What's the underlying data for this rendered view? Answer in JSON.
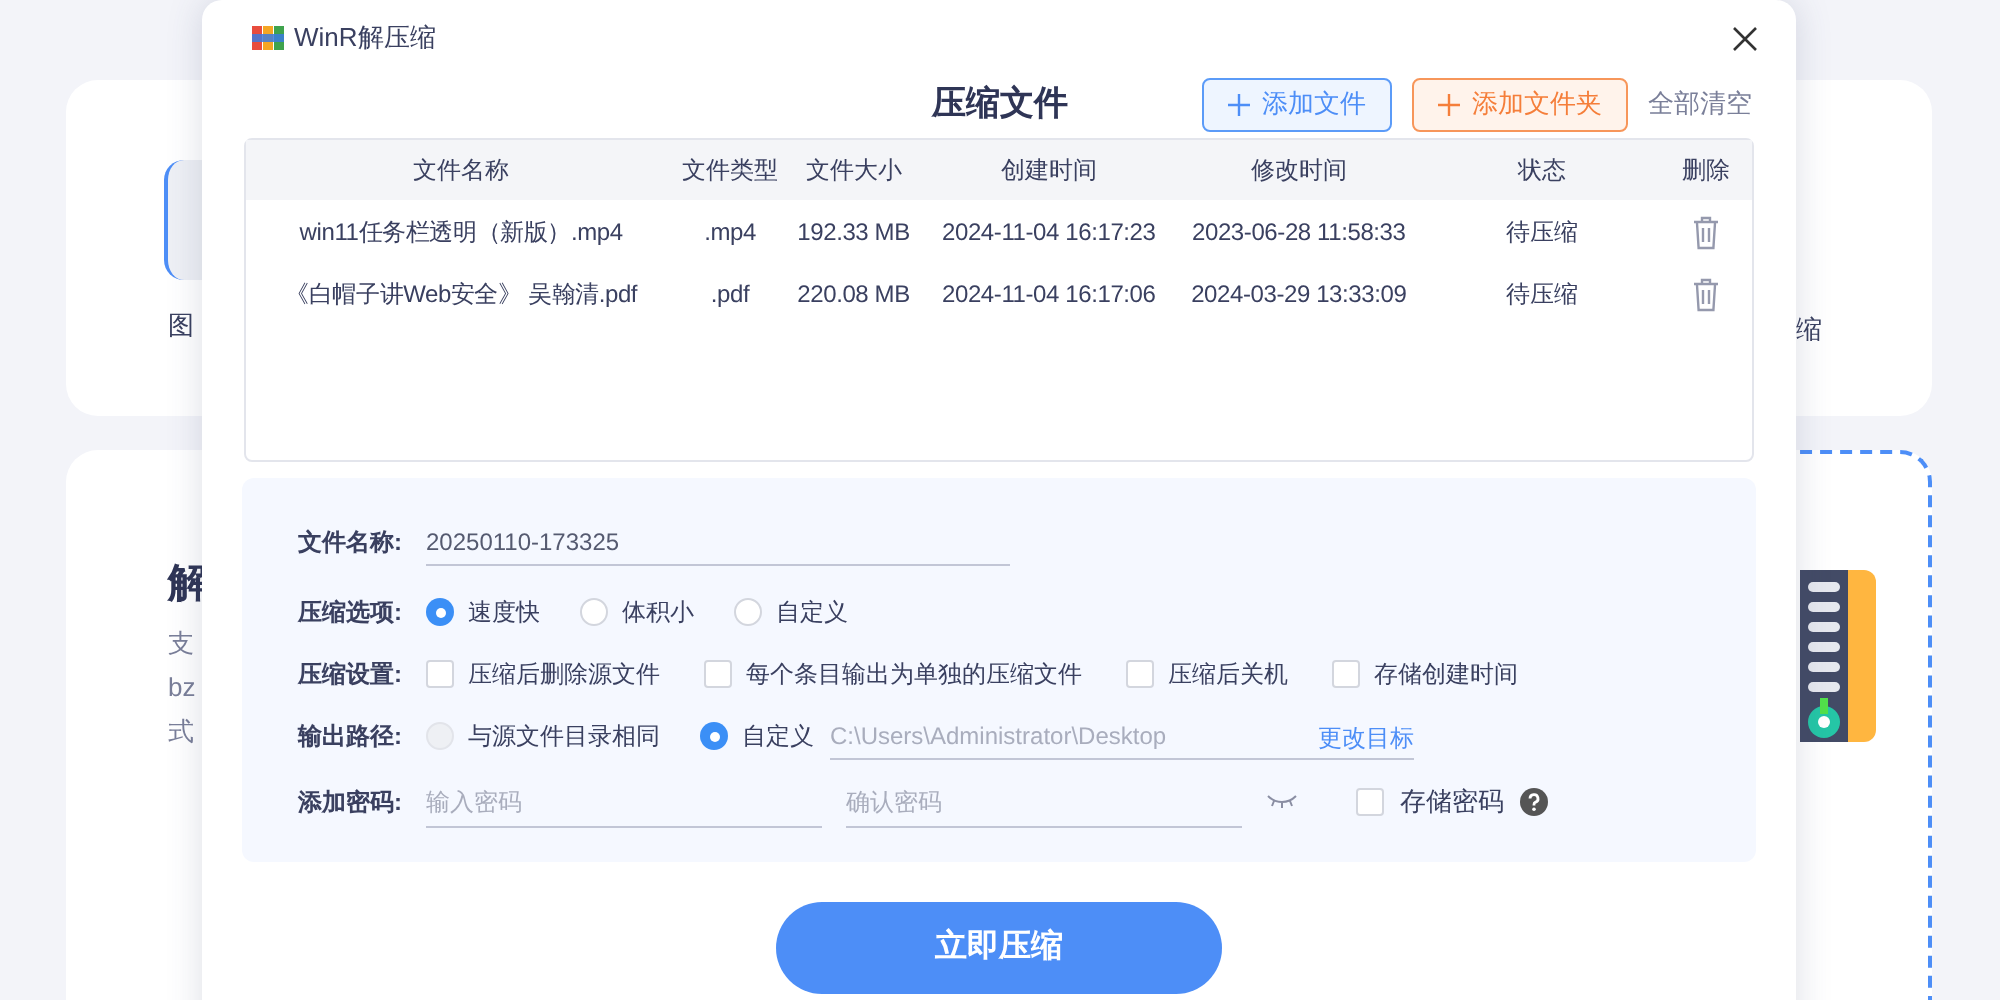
{
  "background": {
    "left_fragments": [
      {
        "text": "图",
        "kind": "caption"
      },
      {
        "text": "解",
        "kind": "heading"
      },
      {
        "text": "支",
        "kind": "body"
      },
      {
        "text": "bz",
        "kind": "body"
      },
      {
        "text": "式",
        "kind": "body"
      }
    ],
    "right_fragments": [
      {
        "text": "缩",
        "kind": "caption"
      }
    ]
  },
  "window": {
    "title": "WinR解压缩"
  },
  "header": {
    "title": "压缩文件",
    "buttons": [
      {
        "label": "添加文件",
        "kind": "primary"
      },
      {
        "label": "添加文件夹",
        "kind": "accent"
      }
    ],
    "clear": "全部清空"
  },
  "table": {
    "columns": [
      "文件名称",
      "文件类型",
      "文件大小",
      "创建时间",
      "修改时间",
      "状态",
      "删除"
    ],
    "rows": [
      {
        "cells": [
          "win11任务栏透明（新版）.mp4",
          ".mp4",
          "192.33 MB",
          "2024-11-04 16:17:23",
          "2023-06-28 11:58:33",
          "待压缩"
        ]
      },
      {
        "cells": [
          "《白帽子讲Web安全》 吴翰清.pdf",
          ".pdf",
          "220.08 MB",
          "2024-11-04 16:17:06",
          "2024-03-29 13:33:09",
          "待压缩"
        ]
      }
    ]
  },
  "settings": {
    "filename": {
      "label": "文件名称:",
      "value": "20250110-173325"
    },
    "options": {
      "label": "压缩选项:",
      "choices": [
        {
          "label": "速度快",
          "selected": true
        },
        {
          "label": "体积小",
          "selected": false
        },
        {
          "label": "自定义",
          "selected": false
        }
      ]
    },
    "flags": {
      "label": "压缩设置:",
      "items": [
        {
          "label": "压缩后删除源文件",
          "checked": false
        },
        {
          "label": "每个条目输出为单独的压缩文件",
          "checked": false
        },
        {
          "label": "压缩后关机",
          "checked": false
        },
        {
          "label": "存储创建时间",
          "checked": false
        }
      ]
    },
    "output": {
      "label": "输出路径:",
      "choices": [
        {
          "label": "与源文件目录相同",
          "selected": false,
          "disabled": true
        },
        {
          "label": "自定义",
          "selected": true,
          "disabled": false
        }
      ],
      "path": "C:\\Users\\Administrator\\Desktop",
      "change": "更改目标"
    },
    "password": {
      "label": "添加密码:",
      "placeholder": "输入密码",
      "confirm_placeholder": "确认密码",
      "remember": {
        "label": "存储密码",
        "checked": false
      }
    }
  },
  "submit": "立即压缩"
}
